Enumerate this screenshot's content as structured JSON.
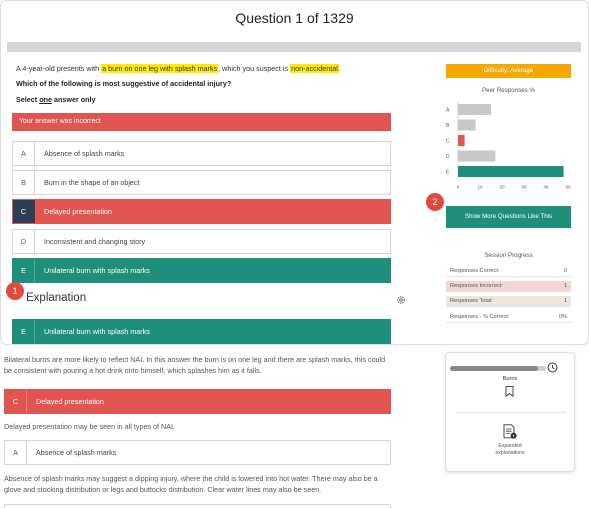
{
  "question": {
    "title": "Question 1 of 1329",
    "stem_pre": "A 4-year-old presents with ",
    "stem_hl1": "a burn on one leg with splash marks",
    "stem_mid": ", which you suspect is ",
    "stem_hl2": "non-accidental",
    "stem_end": ".",
    "prompt": "Which of the following is most suggestive of accidental injury?",
    "select_pre": "Select ",
    "select_one": "one",
    "select_post": " answer only",
    "incorrect_banner": "Your answer was incorrect"
  },
  "options": [
    {
      "letter": "A",
      "text": "Absence of splash marks"
    },
    {
      "letter": "B",
      "text": "Burn in the shape of an object"
    },
    {
      "letter": "C",
      "text": "Delayed presentation"
    },
    {
      "letter": "D",
      "text": "Inconsistent and changing story"
    },
    {
      "letter": "E",
      "text": "Unilateral burn with splash marks"
    }
  ],
  "explanation": {
    "title": "Explanation",
    "correct": {
      "letter": "E",
      "text": "Unilateral burn with splash marks"
    },
    "correct_text": "Bilateral burns are more likely to reflect NAI. In this answer the burn is on one leg and there are splash marks, this could be consistent with pouring a hot drink onto himself, which splashes him as it falls.",
    "c": {
      "letter": "C",
      "text": "Delayed presentation"
    },
    "c_text": "Delayed presentation may be seen in all types of NAI.",
    "a": {
      "letter": "A",
      "text": "Absence of splash marks"
    },
    "a_text": "Absence of splash marks may suggest a dipping injury, where the child is lowered into hot water. There may also be a glove and stocking distribution or legs and buttocks distribution. Clear water lines may also be seen."
  },
  "badges": {
    "one": "1",
    "two": "2"
  },
  "difficulty": "Difficulty: Average",
  "peer_title": "Peer Responses %",
  "chart_data": {
    "type": "bar",
    "orientation": "horizontal",
    "categories": [
      "A",
      "B",
      "C",
      "D",
      "E"
    ],
    "values": [
      15,
      8,
      3,
      17,
      48
    ],
    "colors": [
      "#c8c8c8",
      "#c8c8c8",
      "#e05550",
      "#c8c8c8",
      "#1f8f7a"
    ],
    "xticks": [
      "0",
      "10",
      "20",
      "30",
      "40",
      "50"
    ],
    "xlim": [
      0,
      50
    ]
  },
  "show_more": "Show More Questions Like This",
  "session": {
    "title": "Session Progress",
    "rows": [
      {
        "label": "Responses Correct:",
        "value": "0"
      },
      {
        "label": "Responses Incorrect:",
        "value": "1"
      },
      {
        "label": "Responses Total:",
        "value": "1"
      },
      {
        "label": "Responses - % Correct:",
        "value": "0%"
      }
    ]
  },
  "sidecard": {
    "progress": 0.92,
    "topic": "Burns",
    "expanded_line1": "Expanded",
    "expanded_line2": "explanations"
  },
  "colors": {
    "green": "#1f8f7a",
    "red": "#e05550",
    "navy": "#2c3e55",
    "orange": "#f5a800",
    "badge": "#e04b3c"
  }
}
